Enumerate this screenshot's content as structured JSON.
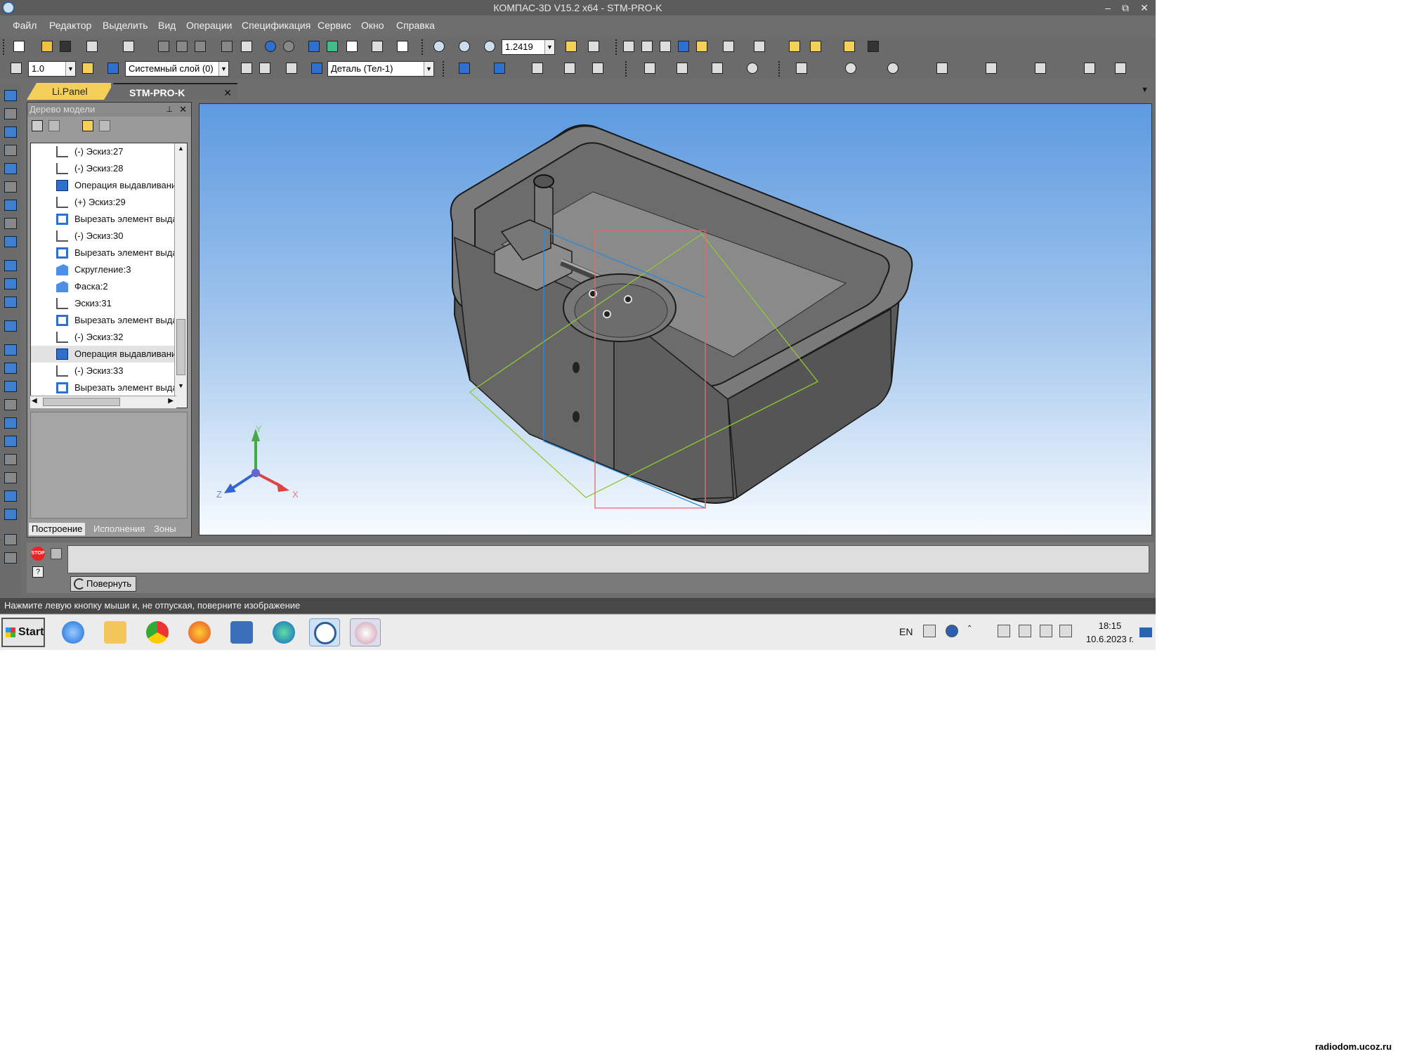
{
  "window": {
    "title": "КОМПАС-3D V15.2  x64 - STM-PRO-K",
    "minimize": "–",
    "maximize": "⧉",
    "close": "✕"
  },
  "menu": [
    "Файл",
    "Редактор",
    "Выделить",
    "Вид",
    "Операции",
    "Спецификация",
    "Сервис",
    "Окно",
    "Справка"
  ],
  "toolbar": {
    "zoom_value": "1.2419",
    "step_value": "1.0",
    "layer_value": "Системный слой (0)",
    "part_value": "Деталь (Тел-1)"
  },
  "tabs": [
    {
      "label": "Li.Panel"
    },
    {
      "label": "STM-PRO-K",
      "close": "✕"
    }
  ],
  "tree": {
    "title": "Дерево модели",
    "pin": "📌",
    "close": "✕",
    "items": [
      {
        "label": "(-) Эскиз:27",
        "type": "sketch"
      },
      {
        "label": "(-) Эскиз:28",
        "type": "sketch"
      },
      {
        "label": "Операция выдавливани",
        "type": "extrude"
      },
      {
        "label": "(+) Эскиз:29",
        "type": "sketch"
      },
      {
        "label": "Вырезать элемент выда",
        "type": "cut"
      },
      {
        "label": "(-) Эскиз:30",
        "type": "sketch"
      },
      {
        "label": "Вырезать элемент выда",
        "type": "cut"
      },
      {
        "label": "Скругление:3",
        "type": "fillet"
      },
      {
        "label": "Фаска:2",
        "type": "fillet"
      },
      {
        "label": "Эскиз:31",
        "type": "sketch"
      },
      {
        "label": "Вырезать элемент выда",
        "type": "cut"
      },
      {
        "label": "(-) Эскиз:32",
        "type": "sketch"
      },
      {
        "label": "Операция выдавливани",
        "type": "extrude",
        "selected": true
      },
      {
        "label": "(-) Эскиз:33",
        "type": "sketch"
      },
      {
        "label": "Вырезать элемент выда",
        "type": "cut"
      }
    ],
    "bottom_tabs": [
      "Построение",
      "Исполнения",
      "Зоны"
    ]
  },
  "viewport": {
    "axis_x": "X",
    "axis_y": "Y",
    "axis_z": "Z"
  },
  "command": {
    "stop": "STOP",
    "rotate_label": "Повернуть"
  },
  "status": {
    "hint": "Нажмите левую кнопку мыши и, не отпуская, поверните изображение"
  },
  "taskbar": {
    "start": "Start",
    "lang": "EN",
    "time": "18:15",
    "date": "10.6.2023 г."
  },
  "watermark": "radiodom.ucoz.ru",
  "colors": {
    "accent": "#2f6fcf",
    "tab_active": "#f4d05a",
    "viewport_top": "#5d9ae0"
  }
}
